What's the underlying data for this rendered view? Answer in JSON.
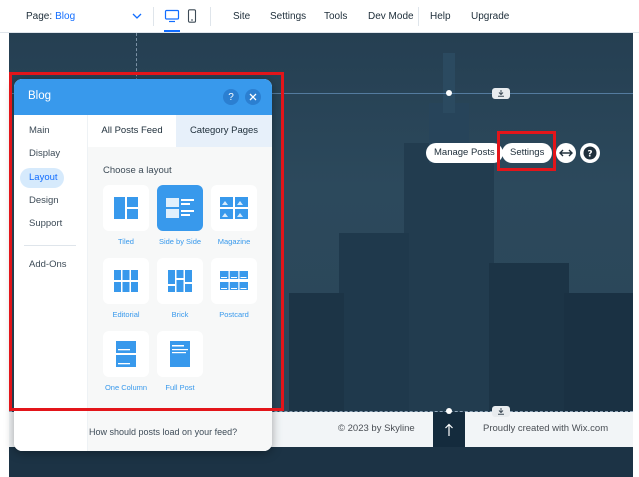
{
  "topbar": {
    "page_prefix": "Page:",
    "page_value": "Blog",
    "menu": [
      "Site",
      "Settings",
      "Tools",
      "Dev Mode",
      "Help",
      "Upgrade"
    ]
  },
  "canvas": {
    "actions": {
      "manage_posts": "Manage Posts",
      "settings": "Settings"
    }
  },
  "footer": {
    "copyright": "© 2023 by Skyline",
    "credit": "Proudly created with Wix.com"
  },
  "panel": {
    "title": "Blog",
    "nav": [
      "Main",
      "Display",
      "Layout",
      "Design",
      "Support",
      "Add-Ons"
    ],
    "active_nav": "Layout",
    "tabs": [
      "All Posts Feed",
      "Category Pages"
    ],
    "active_tab": "All Posts Feed",
    "section_title": "Choose a layout",
    "layouts": [
      "Tiled",
      "Side by Side",
      "Magazine",
      "Editorial",
      "Brick",
      "Postcard",
      "One Column",
      "Full Post"
    ],
    "selected_layout": "Side by Side",
    "question": "How should posts load on your feed?"
  },
  "colors": {
    "accent": "#116dff",
    "panel_header": "#3899ec",
    "highlight": "#e3151a"
  }
}
